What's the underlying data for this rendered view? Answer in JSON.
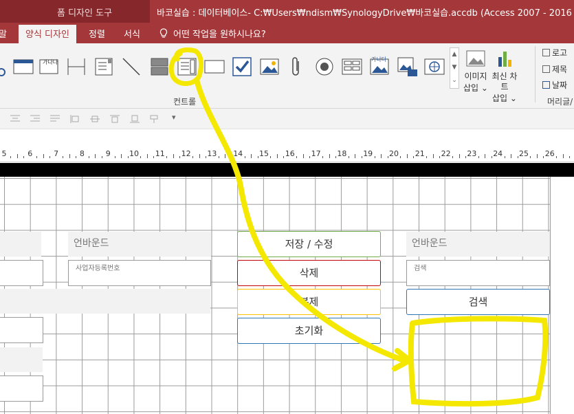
{
  "titlebar": {
    "context_tab": "폼 디자인 도구",
    "window_title": "바코실습 : 데이터베이스- C:₩Users₩ndism₩SynologyDrive₩바코실습.accdb (Access 2007 - 2016 파일 형식)  -"
  },
  "tabs": {
    "cut_left": "말",
    "form_design": "양식 디자인",
    "arrange": "정렬",
    "format": "서식",
    "tell_me": "어떤 작업을 원하시나요?"
  },
  "ribbon": {
    "controls_group": "컨트롤",
    "insert_image": [
      "이미지",
      "삽입 ⌄"
    ],
    "modern_chart": [
      "최신 차트",
      "삽입 ⌄"
    ],
    "logo": "로고",
    "title": "제목",
    "date_time": "날짜",
    "header_footer_group": "머리글/",
    "label_glyph": "가나다",
    "image_glyph": "가나다",
    "gallery_up": "▲",
    "gallery_down": "▼",
    "gallery_more": "⌄",
    "format_dropdown": "▾"
  },
  "ruler": {
    "labels": [
      "5",
      "6",
      "7",
      "8",
      "9",
      "10",
      "11",
      "12",
      "13",
      "14",
      "15",
      "16",
      "17",
      "18",
      "19",
      "20",
      "21",
      "22",
      "23",
      "24",
      "25",
      "26"
    ]
  },
  "form": {
    "unbound_left": "언바운드",
    "business_number": "사업자등록번호",
    "unbound_right": "언바운드",
    "search_field": "검색",
    "save_edit": "저장 / 수정",
    "delete": "삭제",
    "duplicate": "복제",
    "reset": "초기화",
    "search": "검색"
  },
  "colors": {
    "title_bar": "#a4373a",
    "context_tab": "#86282b",
    "annotation": "#f5e800",
    "save_border": "#70ad47",
    "delete_border": "#c00000",
    "duplicate_border": "#ffc000",
    "reset_border": "#2e75b6",
    "search_border": "#2e75b6"
  }
}
